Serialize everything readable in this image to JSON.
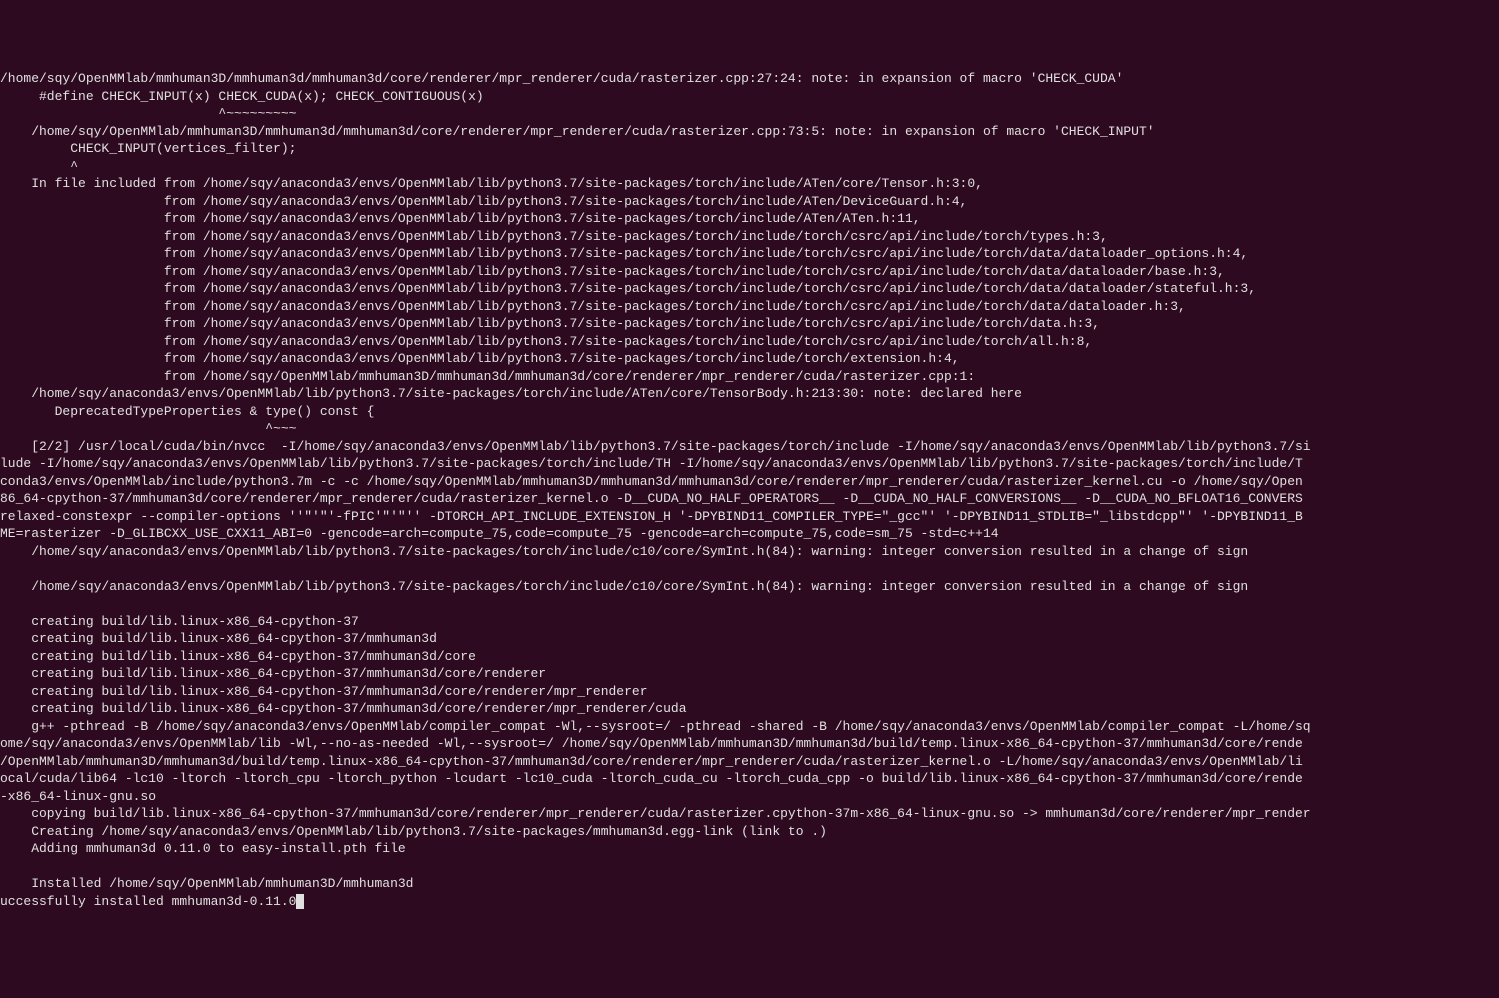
{
  "terminal": {
    "lines": [
      "/home/sqy/OpenMMlab/mmhuman3D/mmhuman3d/mmhuman3d/core/renderer/mpr_renderer/cuda/rasterizer.cpp:27:24: note: in expansion of macro 'CHECK_CUDA'",
      "     #define CHECK_INPUT(x) CHECK_CUDA(x); CHECK_CONTIGUOUS(x)",
      "                            ^~~~~~~~~~",
      "    /home/sqy/OpenMMlab/mmhuman3D/mmhuman3d/mmhuman3d/core/renderer/mpr_renderer/cuda/rasterizer.cpp:73:5: note: in expansion of macro 'CHECK_INPUT'",
      "         CHECK_INPUT(vertices_filter);",
      "         ^",
      "    In file included from /home/sqy/anaconda3/envs/OpenMMlab/lib/python3.7/site-packages/torch/include/ATen/core/Tensor.h:3:0,",
      "                     from /home/sqy/anaconda3/envs/OpenMMlab/lib/python3.7/site-packages/torch/include/ATen/DeviceGuard.h:4,",
      "                     from /home/sqy/anaconda3/envs/OpenMMlab/lib/python3.7/site-packages/torch/include/ATen/ATen.h:11,",
      "                     from /home/sqy/anaconda3/envs/OpenMMlab/lib/python3.7/site-packages/torch/include/torch/csrc/api/include/torch/types.h:3,",
      "                     from /home/sqy/anaconda3/envs/OpenMMlab/lib/python3.7/site-packages/torch/include/torch/csrc/api/include/torch/data/dataloader_options.h:4,",
      "                     from /home/sqy/anaconda3/envs/OpenMMlab/lib/python3.7/site-packages/torch/include/torch/csrc/api/include/torch/data/dataloader/base.h:3,",
      "                     from /home/sqy/anaconda3/envs/OpenMMlab/lib/python3.7/site-packages/torch/include/torch/csrc/api/include/torch/data/dataloader/stateful.h:3,",
      "                     from /home/sqy/anaconda3/envs/OpenMMlab/lib/python3.7/site-packages/torch/include/torch/csrc/api/include/torch/data/dataloader.h:3,",
      "                     from /home/sqy/anaconda3/envs/OpenMMlab/lib/python3.7/site-packages/torch/include/torch/csrc/api/include/torch/data.h:3,",
      "                     from /home/sqy/anaconda3/envs/OpenMMlab/lib/python3.7/site-packages/torch/include/torch/csrc/api/include/torch/all.h:8,",
      "                     from /home/sqy/anaconda3/envs/OpenMMlab/lib/python3.7/site-packages/torch/include/torch/extension.h:4,",
      "                     from /home/sqy/OpenMMlab/mmhuman3D/mmhuman3d/mmhuman3d/core/renderer/mpr_renderer/cuda/rasterizer.cpp:1:",
      "    /home/sqy/anaconda3/envs/OpenMMlab/lib/python3.7/site-packages/torch/include/ATen/core/TensorBody.h:213:30: note: declared here",
      "       DeprecatedTypeProperties & type() const {",
      "                                  ^~~~",
      "    [2/2] /usr/local/cuda/bin/nvcc  -I/home/sqy/anaconda3/envs/OpenMMlab/lib/python3.7/site-packages/torch/include -I/home/sqy/anaconda3/envs/OpenMMlab/lib/python3.7/si",
      "lude -I/home/sqy/anaconda3/envs/OpenMMlab/lib/python3.7/site-packages/torch/include/TH -I/home/sqy/anaconda3/envs/OpenMMlab/lib/python3.7/site-packages/torch/include/T",
      "conda3/envs/OpenMMlab/include/python3.7m -c -c /home/sqy/OpenMMlab/mmhuman3D/mmhuman3d/mmhuman3d/core/renderer/mpr_renderer/cuda/rasterizer_kernel.cu -o /home/sqy/Open",
      "86_64-cpython-37/mmhuman3d/core/renderer/mpr_renderer/cuda/rasterizer_kernel.o -D__CUDA_NO_HALF_OPERATORS__ -D__CUDA_NO_HALF_CONVERSIONS__ -D__CUDA_NO_BFLOAT16_CONVERS",
      "relaxed-constexpr --compiler-options ''\"'\"'-fPIC'\"'\"'' -DTORCH_API_INCLUDE_EXTENSION_H '-DPYBIND11_COMPILER_TYPE=\"_gcc\"' '-DPYBIND11_STDLIB=\"_libstdcpp\"' '-DPYBIND11_B",
      "ME=rasterizer -D_GLIBCXX_USE_CXX11_ABI=0 -gencode=arch=compute_75,code=compute_75 -gencode=arch=compute_75,code=sm_75 -std=c++14",
      "    /home/sqy/anaconda3/envs/OpenMMlab/lib/python3.7/site-packages/torch/include/c10/core/SymInt.h(84): warning: integer conversion resulted in a change of sign",
      "",
      "    /home/sqy/anaconda3/envs/OpenMMlab/lib/python3.7/site-packages/torch/include/c10/core/SymInt.h(84): warning: integer conversion resulted in a change of sign",
      "",
      "    creating build/lib.linux-x86_64-cpython-37",
      "    creating build/lib.linux-x86_64-cpython-37/mmhuman3d",
      "    creating build/lib.linux-x86_64-cpython-37/mmhuman3d/core",
      "    creating build/lib.linux-x86_64-cpython-37/mmhuman3d/core/renderer",
      "    creating build/lib.linux-x86_64-cpython-37/mmhuman3d/core/renderer/mpr_renderer",
      "    creating build/lib.linux-x86_64-cpython-37/mmhuman3d/core/renderer/mpr_renderer/cuda",
      "    g++ -pthread -B /home/sqy/anaconda3/envs/OpenMMlab/compiler_compat -Wl,--sysroot=/ -pthread -shared -B /home/sqy/anaconda3/envs/OpenMMlab/compiler_compat -L/home/sq",
      "ome/sqy/anaconda3/envs/OpenMMlab/lib -Wl,--no-as-needed -Wl,--sysroot=/ /home/sqy/OpenMMlab/mmhuman3D/mmhuman3d/build/temp.linux-x86_64-cpython-37/mmhuman3d/core/rende",
      "/OpenMMlab/mmhuman3D/mmhuman3d/build/temp.linux-x86_64-cpython-37/mmhuman3d/core/renderer/mpr_renderer/cuda/rasterizer_kernel.o -L/home/sqy/anaconda3/envs/OpenMMlab/li",
      "ocal/cuda/lib64 -lc10 -ltorch -ltorch_cpu -ltorch_python -lcudart -lc10_cuda -ltorch_cuda_cu -ltorch_cuda_cpp -o build/lib.linux-x86_64-cpython-37/mmhuman3d/core/rende",
      "-x86_64-linux-gnu.so",
      "    copying build/lib.linux-x86_64-cpython-37/mmhuman3d/core/renderer/mpr_renderer/cuda/rasterizer.cpython-37m-x86_64-linux-gnu.so -> mmhuman3d/core/renderer/mpr_render",
      "    Creating /home/sqy/anaconda3/envs/OpenMMlab/lib/python3.7/site-packages/mmhuman3d.egg-link (link to .)",
      "    Adding mmhuman3d 0.11.0 to easy-install.pth file",
      "",
      "    Installed /home/sqy/OpenMMlab/mmhuman3D/mmhuman3d",
      "uccessfully installed mmhuman3d-0.11.0"
    ]
  }
}
